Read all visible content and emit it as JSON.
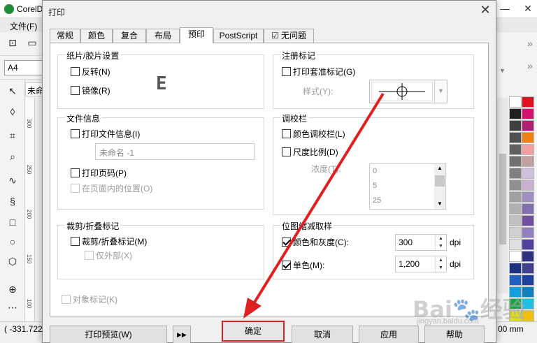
{
  "app": {
    "title": "CorelD",
    "menu_file": "文件(F)",
    "page_size": "A4",
    "doc_tab": "未命",
    "coord": "( -331.722",
    "unit_suffix": "00 mm",
    "ruler_marks": [
      "300",
      "250",
      "200",
      "150",
      "100"
    ]
  },
  "dialog": {
    "title": "打印",
    "tabs": [
      {
        "label": "常规"
      },
      {
        "label": "颜色"
      },
      {
        "label": "复合"
      },
      {
        "label": "布局"
      },
      {
        "label": "预印",
        "active": true
      },
      {
        "label": "PostScript"
      },
      {
        "label": "无问题",
        "has_icon": true
      }
    ],
    "paper_film": {
      "title": "纸片/胶片设置",
      "invert": {
        "label": "反转(N)",
        "checked": false
      },
      "mirror": {
        "label": "镜像(R)",
        "checked": false
      }
    },
    "file_info": {
      "title": "文件信息",
      "print_file_info": {
        "label": "打印文件信息(I)",
        "checked": false
      },
      "file_name_value": "未命名 -1",
      "print_page_num": {
        "label": "打印页码(P)",
        "checked": false
      },
      "inside_page": {
        "label": "在页面内的位置(O)",
        "checked": false,
        "disabled": true
      }
    },
    "crop_fold": {
      "title": "裁剪/折叠标记",
      "crop_marks": {
        "label": "裁剪/折叠标记(M)",
        "checked": false
      },
      "exterior_only": {
        "label": "仅外部(X)",
        "checked": false,
        "disabled": true
      }
    },
    "registration": {
      "title": "注册标记",
      "print_reg": {
        "label": "打印套准标记(G)",
        "checked": false
      },
      "style_label": "样式(Y):"
    },
    "calibration": {
      "title": "调校栏",
      "color_bar": {
        "label": "颜色调校栏(L)",
        "checked": false
      },
      "density_scale": {
        "label": "尺度比例(D)",
        "checked": false
      },
      "density_label": "浓度(T):",
      "density_values": [
        "0",
        "5",
        "25"
      ]
    },
    "downsample": {
      "title": "位图缩减取样",
      "color_gray": {
        "label": "颜色和灰度(C):",
        "checked": true,
        "value": "300",
        "unit": "dpi"
      },
      "mono": {
        "label": "单色(M):",
        "checked": true,
        "value": "1,200",
        "unit": "dpi"
      }
    },
    "object_marks": {
      "label": "对象标记(K)",
      "checked": false,
      "disabled": true
    },
    "buttons": {
      "print_preview": "打印预览(W)",
      "expand": "▶▶",
      "ok": "确定",
      "cancel": "取消",
      "apply": "应用",
      "help": "帮助"
    }
  },
  "watermark": {
    "main": "Bai🐾经验",
    "sub": "jingyan.baidu.com"
  },
  "colors": {
    "annotation": "#e02020"
  }
}
